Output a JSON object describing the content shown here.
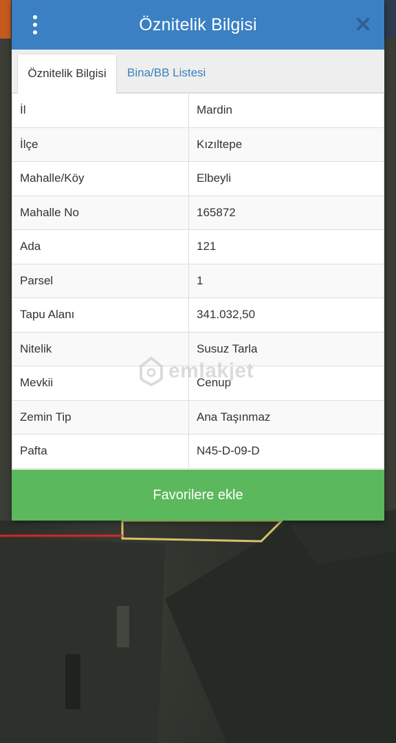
{
  "header": {
    "title": "Öznitelik Bilgisi",
    "menu_icon": "more-vertical-icon",
    "close_icon": "close-icon"
  },
  "tabs": [
    {
      "label": "Öznitelik Bilgisi",
      "active": true
    },
    {
      "label": "Bina/BB Listesi",
      "active": false
    }
  ],
  "attributes": [
    {
      "key": "İl",
      "value": "Mardin"
    },
    {
      "key": "İlçe",
      "value": "Kızıltepe"
    },
    {
      "key": "Mahalle/Köy",
      "value": "Elbeyli"
    },
    {
      "key": "Mahalle No",
      "value": "165872"
    },
    {
      "key": "Ada",
      "value": "121"
    },
    {
      "key": "Parsel",
      "value": "1"
    },
    {
      "key": "Tapu Alanı",
      "value": "341.032,50"
    },
    {
      "key": "Nitelik",
      "value": "Susuz Tarla"
    },
    {
      "key": "Mevkii",
      "value": "Cenup"
    },
    {
      "key": "Zemin Tip",
      "value": "Ana Taşınmaz"
    },
    {
      "key": "Pafta",
      "value": "N45-D-09-D"
    }
  ],
  "actions": {
    "favorite_label": "Favorilere ekle"
  },
  "watermark": {
    "text": "emlakjet"
  },
  "colors": {
    "header_bg": "#3a80c3",
    "button_bg": "#5cb85c",
    "tab_link": "#3a7fbf"
  }
}
